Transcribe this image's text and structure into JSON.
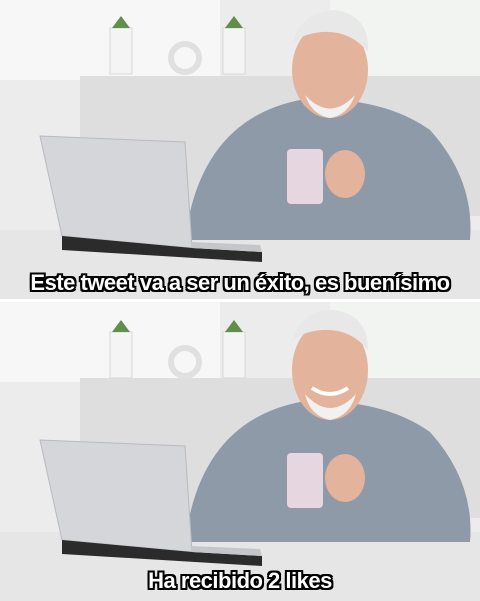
{
  "meme": {
    "top_caption": "Este tweet va a ser un éxito, es buenísimo",
    "bottom_caption": "Ha recibido 2 likes"
  },
  "colors": {
    "wall": "#ececec",
    "window": "#f7f7f7",
    "desk": "#e6e6e6",
    "laptop": "#d4d6d9",
    "laptop_base": "#2b2b2b",
    "shirt": "#8f9aa8",
    "skin": "#e3b39b",
    "hair": "#e8e8e8",
    "mug": "#e6d6e0",
    "plant": "#5f8f4a"
  }
}
